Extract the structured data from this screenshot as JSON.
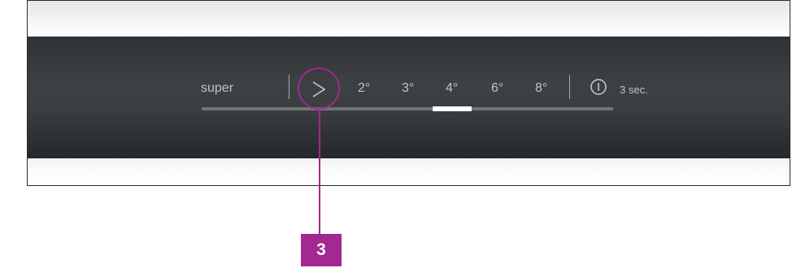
{
  "control_panel": {
    "super_label": "super",
    "temperatures": [
      "2°",
      "3°",
      "4°",
      "6°",
      "8°"
    ],
    "selected_temperature": "4°",
    "power_hold_label": "3 sec."
  },
  "callout": {
    "number": "3"
  },
  "icons": {
    "arrow": "chevron-right-icon",
    "power": "power-icon"
  },
  "colors": {
    "panel": "#3a3e40",
    "text": "#bfc3c5",
    "callout": "#a1298f"
  }
}
